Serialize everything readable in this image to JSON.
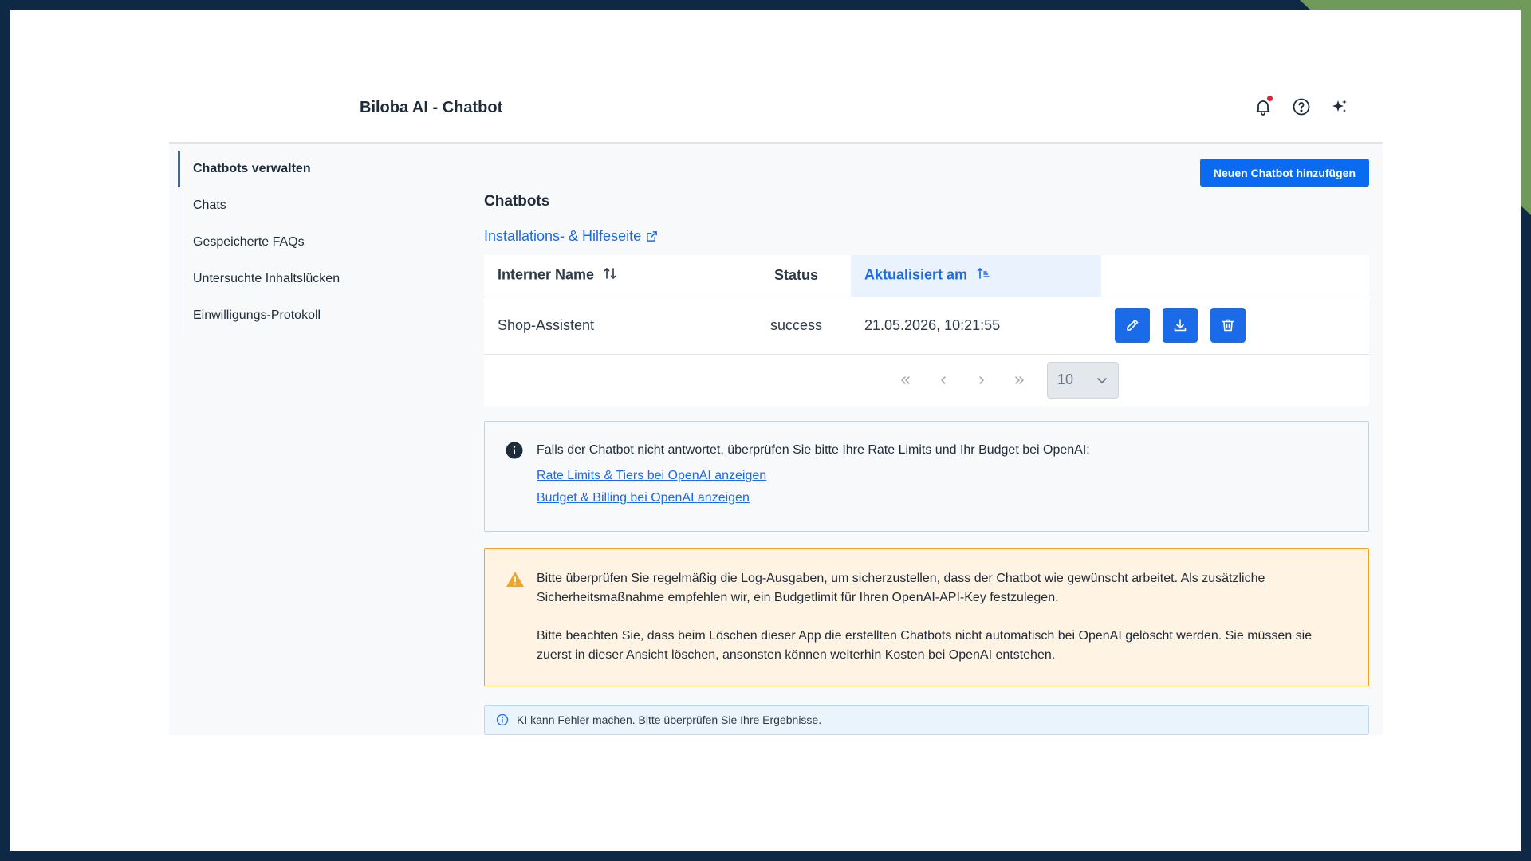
{
  "app": {
    "title": "Biloba AI - Chatbot",
    "header_icons": [
      "bell-icon",
      "help-circle-icon",
      "sparkles-icon"
    ]
  },
  "sidebar": {
    "items": [
      {
        "label": "Chatbots verwalten",
        "active": true
      },
      {
        "label": "Chats",
        "active": false
      },
      {
        "label": "Gespeicherte FAQs",
        "active": false
      },
      {
        "label": "Untersuchte Inhaltslücken",
        "active": false
      },
      {
        "label": "Einwilligungs-Protokoll",
        "active": false
      }
    ]
  },
  "main": {
    "add_button": "Neuen Chatbot hinzufügen",
    "section_title": "Chatbots",
    "help_link": "Installations- & Hilfeseite",
    "table": {
      "columns": [
        {
          "label": "Interner Name",
          "sortable": true,
          "sorted": false
        },
        {
          "label": "Status",
          "sortable": false,
          "sorted": false
        },
        {
          "label": "Aktualisiert am",
          "sortable": true,
          "sorted": true
        }
      ],
      "rows": [
        {
          "name": "Shop-Assistent",
          "status": "success",
          "updated": "21.05.2026, 10:21:55",
          "actions": [
            "edit-icon",
            "download-icon",
            "trash-icon"
          ]
        }
      ]
    },
    "pagination": {
      "buttons": [
        "first-page-icon",
        "prev-page-icon",
        "next-page-icon",
        "last-page-icon"
      ],
      "page_size": "10"
    },
    "info_box": {
      "text": "Falls der Chatbot nicht antwortet, überprüfen Sie bitte Ihre Rate Limits und Ihr Budget bei OpenAI:",
      "link1": "Rate Limits & Tiers bei OpenAI anzeigen",
      "link2": "Budget & Billing bei OpenAI anzeigen"
    },
    "warning_box": {
      "p1": "Bitte überprüfen Sie regelmäßig die Log-Ausgaben, um sicherzustellen, dass der Chatbot wie gewünscht arbeitet. Als zusätzliche Sicherheitsmaßnahme empfehlen wir, ein Budgetlimit für Ihren OpenAI-API-Key festzulegen.",
      "p2": "Bitte beachten Sie, dass beim Löschen dieser App die erstellten Chatbots nicht automatisch bei OpenAI gelöscht werden. Sie müssen sie zuerst in dieser Ansicht löschen, ansonsten können weiterhin Kosten bei OpenAI entstehen."
    },
    "ai_note": "KI kann Fehler machen. Bitte überprüfen Sie Ihre Ergebnisse."
  },
  "colors": {
    "accent": "#1b6ae8",
    "primary_button": "#0b6bf0",
    "warning_border": "#f0a325",
    "warning_bg": "#fff3e3",
    "frame": "#0f2846",
    "frame_accent": "#6f9a5a"
  }
}
